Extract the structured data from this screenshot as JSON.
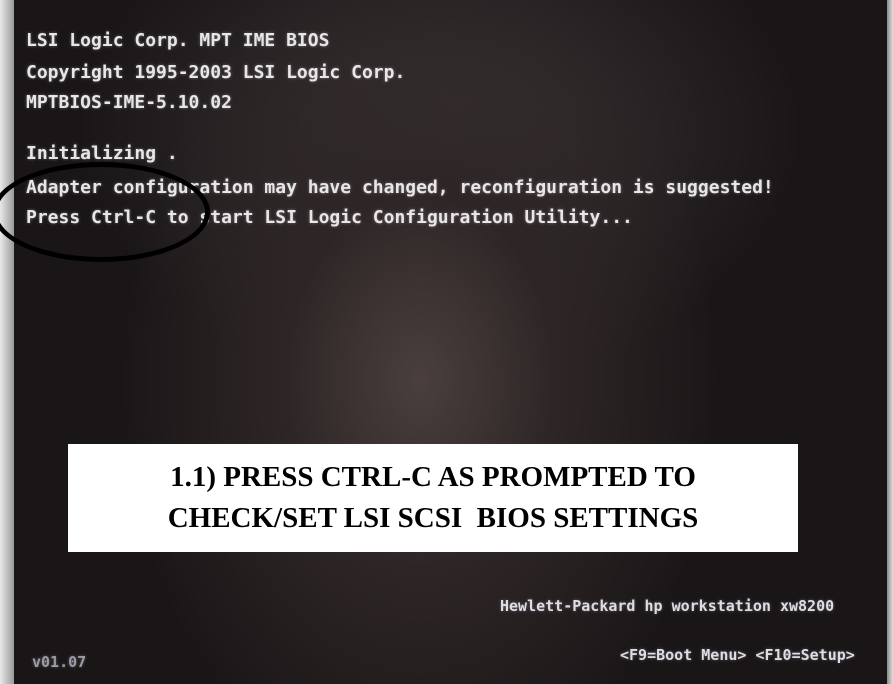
{
  "bios": {
    "lines": [
      "LSI Logic Corp. MPT IME BIOS",
      "Copyright 1995-2003 LSI Logic Corp.",
      "MPTBIOS-IME-5.10.02",
      "Initializing .",
      "Adapter configuration may have changed, reconfiguration is suggested!",
      "Press Ctrl-C to start LSI Logic Configuration Utility..."
    ],
    "system_line": "Hewlett-Packard hp workstation xw8200",
    "version": "v01.07",
    "hotkeys": "<F9=Boot Menu> <F10=Setup>"
  },
  "instruction": {
    "line1": "1.1) PRESS CTRL-C AS PROMPTED TO",
    "line2": "CHECK/SET LSI SCSI  BIOS SETTINGS"
  },
  "colors": {
    "bios_text": "#e9e6ea",
    "annotation_box": "#ffffff",
    "annotation_text": "#000000",
    "callout_ellipse": "#000000"
  }
}
